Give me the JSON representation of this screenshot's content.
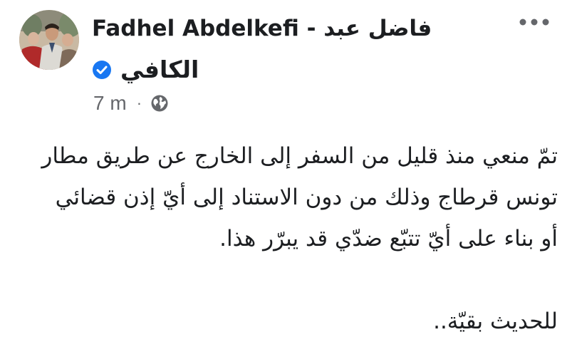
{
  "post": {
    "author": {
      "name_line_1": "Fadhel Abdelkefi - فاضل عبد",
      "name_line_2": "الكافي",
      "verified": true,
      "avatar_icon": "profile-photo"
    },
    "meta": {
      "time": "7 m",
      "separator": "·",
      "audience_icon": "globe-icon"
    },
    "more_icon": "more-options-icon",
    "body": {
      "lines": [
        "تمّ منعي منذ قليل من السفر إلى الخارج عن طريق مطار",
        "تونس قرطاج وذلك من دون الاستناد إلى أيّ إذن قضائي",
        "أو بناء على أيّ تتبّع ضدّي قد يبرّر هذا."
      ],
      "closing": "للحديث بقيّة.."
    },
    "colors": {
      "text_primary": "#1c1e21",
      "text_secondary": "#65676b",
      "verified_blue": "#1877f2"
    }
  }
}
